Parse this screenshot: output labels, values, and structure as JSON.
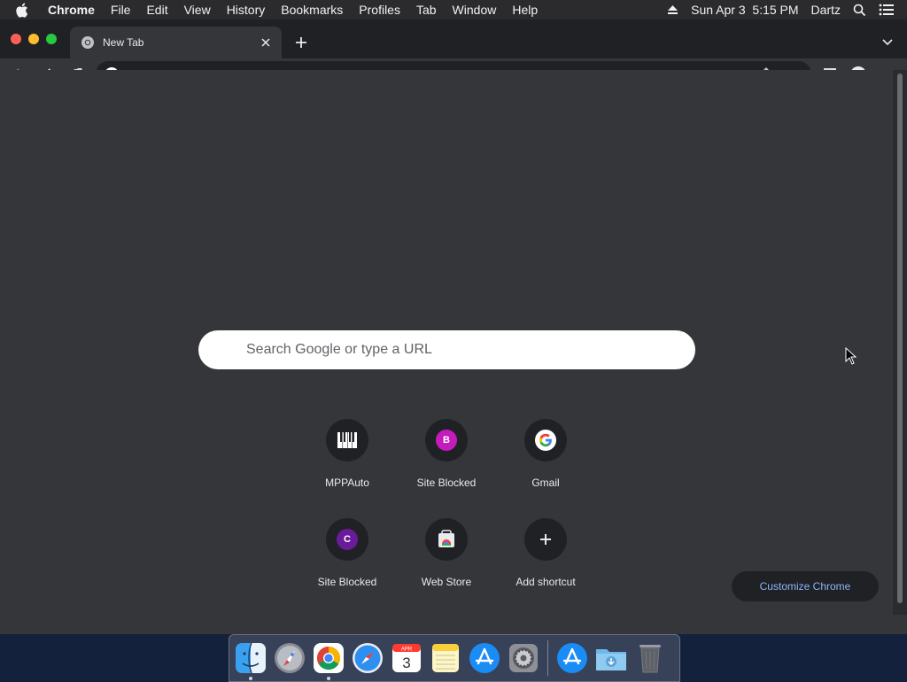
{
  "menubar": {
    "app_name": "Chrome",
    "items": [
      "File",
      "Edit",
      "View",
      "History",
      "Bookmarks",
      "Profiles",
      "Tab",
      "Window",
      "Help"
    ],
    "datetime": "Sun Apr 3  5:15 PM",
    "user": "Dartz"
  },
  "tab": {
    "title": "New Tab"
  },
  "toolbar": {
    "omnibox_placeholder": "Search Google or type a URL"
  },
  "ntp": {
    "search_placeholder": "Search Google or type a URL",
    "shortcuts": [
      {
        "label": "MPPAuto",
        "icon": "piano-icon"
      },
      {
        "label": "Site Blocked",
        "icon": "letter-b-icon",
        "letter": "B",
        "color": "#c41bbd"
      },
      {
        "label": "Gmail",
        "icon": "google-g-icon"
      },
      {
        "label": "Site Blocked",
        "icon": "letter-c-icon",
        "letter": "C",
        "color": "#6a1b9a"
      },
      {
        "label": "Web Store",
        "icon": "web-store-icon"
      },
      {
        "label": "Add shortcut",
        "icon": "plus-icon"
      }
    ],
    "customize_label": "Customize Chrome"
  },
  "dock": {
    "apps": [
      "Finder",
      "Launchpad",
      "Google Chrome",
      "Safari",
      "Calendar",
      "Notes",
      "App Store",
      "System Preferences",
      "App Store",
      "Downloads",
      "Trash"
    ],
    "calendar": {
      "month": "APR",
      "day": "3"
    }
  },
  "colors": {
    "menubar_bg": "#2b2b2d",
    "tabstrip_bg": "#202124",
    "toolbar_bg": "#35363a",
    "link_blue": "#8ab4f8",
    "desktop_bg": "#14213d"
  }
}
